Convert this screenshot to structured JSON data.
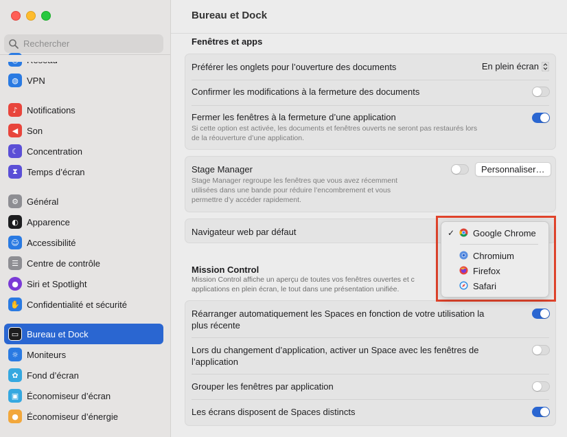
{
  "sidebar": {
    "search_placeholder": "Rechercher",
    "items": [
      {
        "label": "Réseau",
        "icon": "network-icon",
        "color": "#2a7ae2"
      },
      {
        "label": "VPN",
        "icon": "vpn-icon",
        "color": "#2a7ae2"
      },
      {
        "label": "Notifications",
        "icon": "bell-icon",
        "color": "#e8453c"
      },
      {
        "label": "Son",
        "icon": "speaker-icon",
        "color": "#e8453c"
      },
      {
        "label": "Concentration",
        "icon": "moon-icon",
        "color": "#5b4fd6"
      },
      {
        "label": "Temps d’écran",
        "icon": "hourglass-icon",
        "color": "#5b4fd6"
      },
      {
        "label": "Général",
        "icon": "gear-icon",
        "color": "#8e8e93"
      },
      {
        "label": "Apparence",
        "icon": "appearance-icon",
        "color": "#1d1d1f"
      },
      {
        "label": "Accessibilité",
        "icon": "accessibility-icon",
        "color": "#2a7ae2"
      },
      {
        "label": "Centre de contrôle",
        "icon": "control-center-icon",
        "color": "#8e8e93"
      },
      {
        "label": "Siri et Spotlight",
        "icon": "siri-icon",
        "color": "#7a3ad6"
      },
      {
        "label": "Confidentialité et sécurité",
        "icon": "hand-icon",
        "color": "#2a7ae2"
      },
      {
        "label": "Bureau et Dock",
        "icon": "dock-icon",
        "color": "#1d1d1f",
        "active": true
      },
      {
        "label": "Moniteurs",
        "icon": "sun-icon",
        "color": "#2a7ae2"
      },
      {
        "label": "Fond d’écran",
        "icon": "wallpaper-icon",
        "color": "#35a8e0"
      },
      {
        "label": "Économiseur d’écran",
        "icon": "screensaver-icon",
        "color": "#35a8e0"
      },
      {
        "label": "Économiseur d’énergie",
        "icon": "bulb-icon",
        "color": "#f2a73b"
      }
    ]
  },
  "header": {
    "title": "Bureau et Dock"
  },
  "windows_apps": {
    "heading": "Fenêtres et apps",
    "prefer_tabs": {
      "label": "Préférer les onglets pour l’ouverture des documents",
      "value": "En plein écran"
    },
    "confirm_changes": {
      "label": "Confirmer les modifications à la fermeture des documents",
      "on": false
    },
    "close_windows": {
      "label": "Fermer les fenêtres à la fermeture d’une application",
      "desc1": "Si cette option est activée, les documents et fenêtres ouverts ne seront pas restaurés lors",
      "desc2": "de la réouverture d’une application.",
      "on": true
    }
  },
  "stage_manager": {
    "label": "Stage Manager",
    "desc1": "Stage Manager regroupe les fenêtres que vous avez récemment",
    "desc2": "utilisées dans une bande pour réduire l’encombrement et vous",
    "desc3": "permettre d’y accéder rapidement.",
    "on": false,
    "customize_button": "Personnaliser…"
  },
  "default_browser": {
    "label": "Navigateur web par défaut",
    "menu": [
      {
        "label": "Google Chrome",
        "checked": true,
        "icon": "chrome-icon"
      },
      {
        "label": "Chromium",
        "checked": false,
        "icon": "chromium-icon"
      },
      {
        "label": "Firefox",
        "checked": false,
        "icon": "firefox-icon"
      },
      {
        "label": "Safari",
        "checked": false,
        "icon": "safari-icon"
      }
    ],
    "check_mark": "✓"
  },
  "mission_control": {
    "heading": "Mission Control",
    "desc1": "Mission Control affiche un aperçu de toutes vos fenêtres ouvertes et c",
    "desc2": "applications en plein écran, le tout dans une présentation unifiée.",
    "rearrange": {
      "line1": "Réarranger automatiquement les Spaces en fonction de votre utilisation la",
      "line2": "plus récente",
      "on": true
    },
    "switch_app": {
      "line1": "Lors du changement d’application, activer un Space avec les fenêtres de",
      "line2": "l’application",
      "on": false
    },
    "group_windows": {
      "label": "Grouper les fenêtres par application",
      "on": false
    },
    "separate_spaces": {
      "label": "Les écrans disposent de Spaces distincts",
      "on": true
    }
  },
  "colors": {
    "accent": "#2a66d1",
    "highlight_box": "#e0432b"
  }
}
